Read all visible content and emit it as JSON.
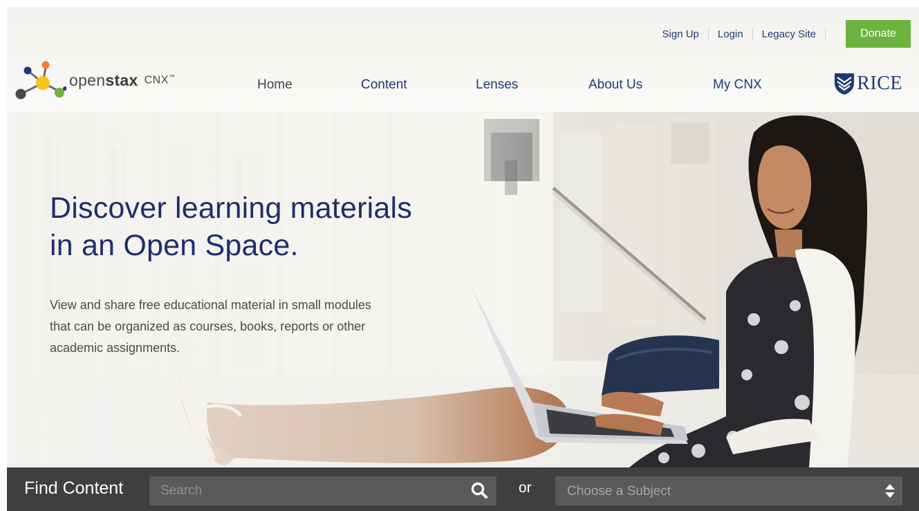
{
  "header": {
    "utility": {
      "signup": "Sign Up",
      "login": "Login",
      "legacy": "Legacy Site",
      "donate": "Donate"
    },
    "logo": {
      "brand_light": "open",
      "brand_bold": "stax",
      "product": "CNX",
      "trademark": "™"
    },
    "nav": [
      "Home",
      "Content",
      "Lenses",
      "About Us",
      "My CNX"
    ],
    "partner": "RICE"
  },
  "hero": {
    "title_line1": "Discover learning materials",
    "title_line2": "in an Open Space.",
    "subtitle_line1": "View and share free educational material in small modules",
    "subtitle_line2": "that can be organized as courses, books, reports or other",
    "subtitle_line3": "academic assignments."
  },
  "find": {
    "label": "Find Content",
    "search_placeholder": "Search",
    "or": "or",
    "subject_selected": "Choose a Subject"
  },
  "colors": {
    "nav_blue": "#1f3a73",
    "title_blue": "#1f2d6b",
    "donate_green": "#6db33f",
    "findbar_bg": "#3f3f3f",
    "input_bg": "#5a5a5a"
  },
  "icons": {
    "logo": "openstax-molecule-icon",
    "partner": "rice-shield-icon",
    "search": "search-icon",
    "select": "chevron-up-down-icon"
  }
}
